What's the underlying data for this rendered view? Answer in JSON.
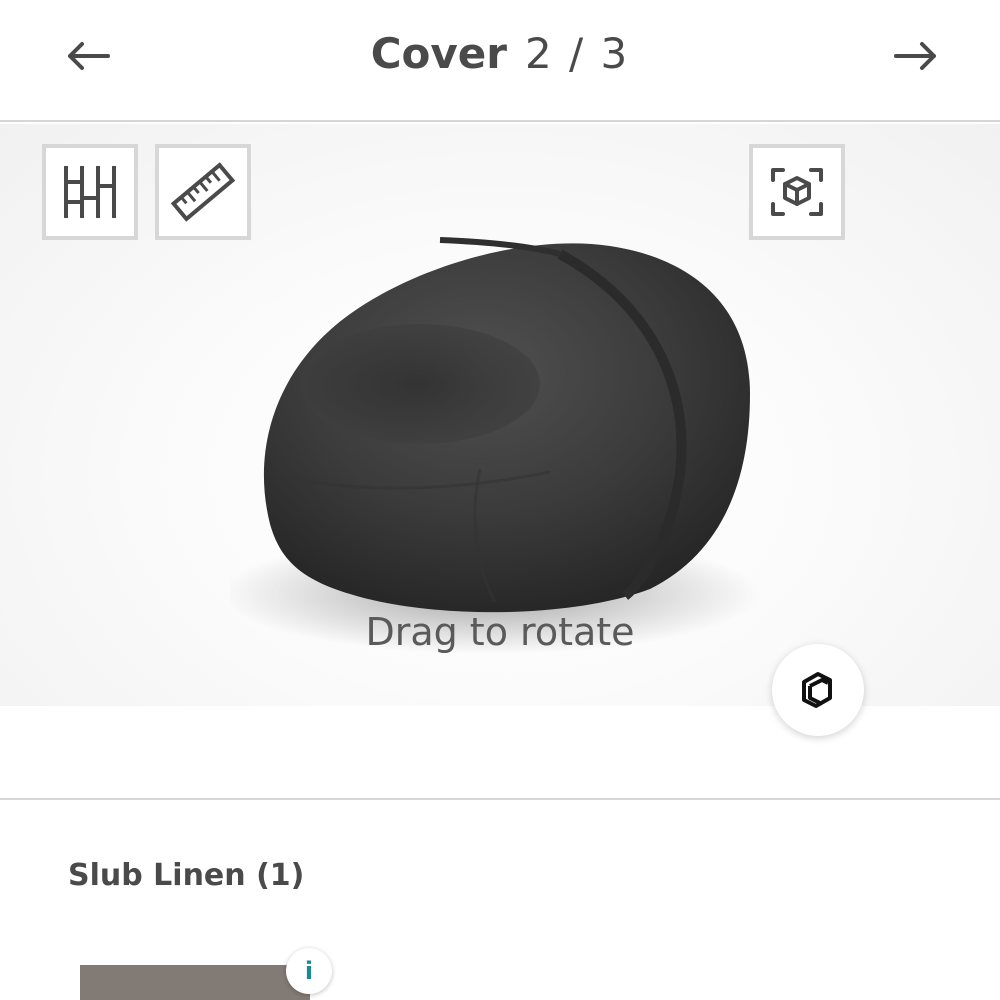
{
  "header": {
    "title": "Cover",
    "counter": "2 / 3",
    "prev_icon": "arrow-left-icon",
    "next_icon": "arrow-right-icon"
  },
  "viewer": {
    "tools": [
      {
        "name": "panel-layout-icon"
      },
      {
        "name": "ruler-icon"
      },
      {
        "name": "ar-cube-icon"
      }
    ],
    "product_image": "dark-gray-bean-bag-chair",
    "hint": "Drag to rotate",
    "materials_icon": "layers-icon"
  },
  "fabric": {
    "title": "Slub Linen (1)",
    "swatch_color": "#827a75",
    "info_label": "i"
  },
  "colors": {
    "text": "#4a4a4a",
    "divider": "#d6d6d6",
    "tool_border": "#d7d7d7",
    "info_accent": "#1b8a96",
    "bag": "#3a3a3a"
  }
}
